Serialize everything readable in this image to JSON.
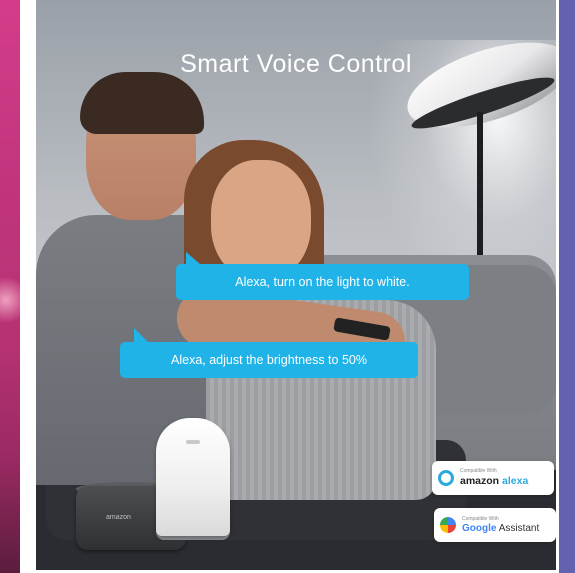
{
  "title": "Smart Voice Control",
  "bubbles": [
    {
      "text": "Alexa, turn on the light to white."
    },
    {
      "text": "Alexa, adjust the brightness to 50%"
    }
  ],
  "speakers": {
    "round_label": "amazon"
  },
  "badges": {
    "alexa": {
      "small_text": "Compatible With",
      "brand": "amazon",
      "product": "alexa"
    },
    "google": {
      "small_text": "Compatible With",
      "brand": "Google",
      "product": "Assistant"
    }
  },
  "colors": {
    "bubble": "#1fb3e8",
    "left_strip": "#c2357f",
    "right_strip": "#6462b0"
  },
  "icons": [
    "alexa-ring-icon",
    "google-assistant-icon"
  ]
}
